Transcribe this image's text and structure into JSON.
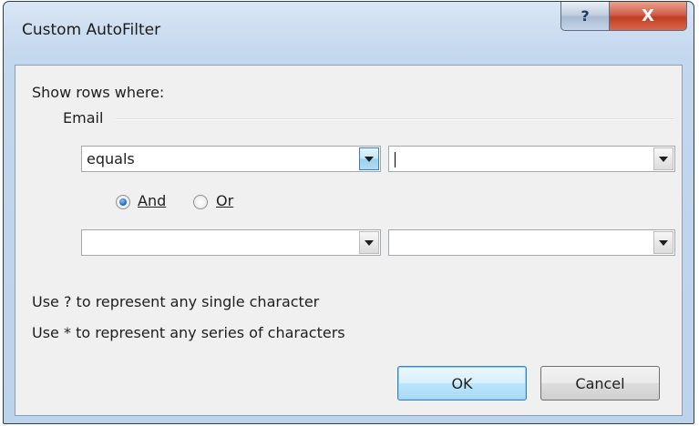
{
  "window": {
    "title": "Custom AutoFilter",
    "help_glyph": "?",
    "close_glyph": "X"
  },
  "filter": {
    "heading": "Show rows where:",
    "column_name": "Email",
    "row1": {
      "operator": "equals",
      "value": ""
    },
    "logic": {
      "and_label": "And",
      "or_label": "Or",
      "selected": "And"
    },
    "row2": {
      "operator": "",
      "value": ""
    }
  },
  "hints": {
    "line1": "Use ? to represent any single character",
    "line2": "Use * to represent any series of characters"
  },
  "buttons": {
    "ok": "OK",
    "cancel": "Cancel"
  },
  "colors": {
    "client_bg": "#f0f0f0",
    "title_bar": "#c3d7ee",
    "close_red": "#c03d23",
    "focus_blue": "#3c7fb1"
  }
}
